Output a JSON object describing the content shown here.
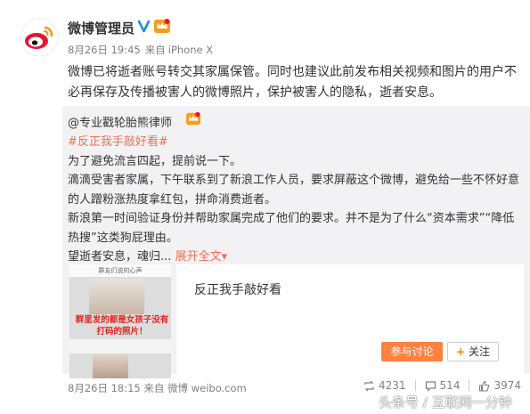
{
  "post": {
    "author": "微博管理员",
    "time": "8月26日 19:45",
    "via": "来自",
    "device": "iPhone X",
    "text": "微博已将逝者账号转交其家属保管。同时也建议此前发布相关视频和图片的用户不必再保存及传播被害人的微博照片，保护被害人的隐私，逝者安息。"
  },
  "repost": {
    "author": "@专业戳轮胎熊律师",
    "hashtag": "#反正我手敲好看#",
    "lines": [
      "为了避免流言四起，提前说一下。",
      "滴滴受害者家属，下午联系到了新浪工作人员，要求屏蔽这个微博，避免给一些不怀好意的人蹭粉涨热度拿红包，拼命消费逝者。",
      "新浪第一时间验证身份并帮助家属完成了他们的要求。并不是为了什么“资本需求”“降低热搜”这类狗屁理由。",
      "望逝者安息，魂归"
    ],
    "ellipsis": "...",
    "expand": "展开全文",
    "expand_arrow": "▾",
    "thumb": {
      "header": "群友们说的心声",
      "caption": "群里发的都是女孩子没有打码的照片！"
    },
    "link_card": {
      "title": "反正我手敲好看",
      "join_label": "参与讨论",
      "follow_plus": "+",
      "follow_label": "关注"
    },
    "time": "8月26日 18:15",
    "via": "来自",
    "source": "微博 weibo.com",
    "reposts": "4231",
    "comments": "514",
    "likes": "3974"
  },
  "watermark": "头条号 / 互联网一分钟",
  "colors": {
    "accent_orange": "#eb7350",
    "button_orange": "#ff8140",
    "repost_bg": "#f2f2f5",
    "muted_text": "#808080"
  },
  "icons": [
    "weibo-logo-icon",
    "verified-icon",
    "vip-crown-icon",
    "repost-icon",
    "comment-icon",
    "like-icon"
  ]
}
